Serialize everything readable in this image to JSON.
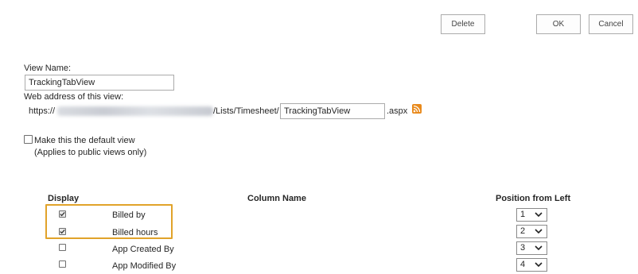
{
  "toolbar": {
    "delete_label": "Delete",
    "ok_label": "OK",
    "cancel_label": "Cancel"
  },
  "view_name": {
    "label": "View Name:",
    "value": "TrackingTabView"
  },
  "web_address": {
    "label": "Web address of this view:",
    "prefix": "https://",
    "path": "/Lists/Timesheet/",
    "filename": "TrackingTabView",
    "extension": ".aspx",
    "rss_icon": "rss-feed-icon"
  },
  "default_view": {
    "checked": false,
    "label": "Make this the default view",
    "note": "(Applies to public views only)"
  },
  "columns_table": {
    "headers": {
      "display": "Display",
      "column_name": "Column Name",
      "position": "Position from Left"
    },
    "rows": [
      {
        "checked": true,
        "name": "Billed by",
        "position": "1"
      },
      {
        "checked": true,
        "name": "Billed hours",
        "position": "2"
      },
      {
        "checked": false,
        "name": "App Created By",
        "position": "3"
      },
      {
        "checked": false,
        "name": "App Modified By",
        "position": "4"
      }
    ]
  },
  "colors": {
    "highlight": "#e1a32a",
    "rss": "#e98a1c"
  }
}
